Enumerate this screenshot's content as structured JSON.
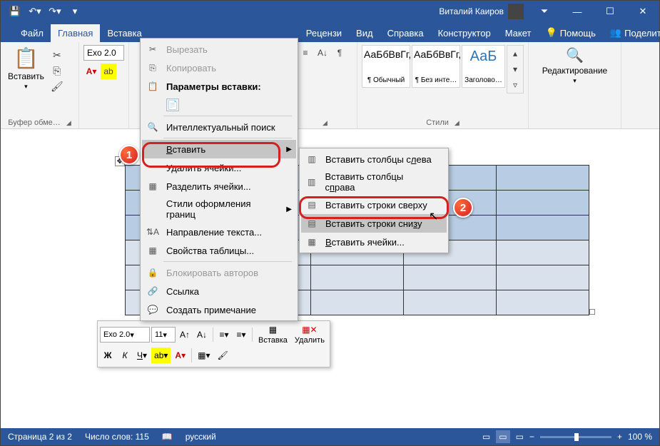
{
  "titlebar": {
    "user": "Виталий Каиров"
  },
  "tabs": {
    "file": "Файл",
    "home": "Главная",
    "insert": "Вставка",
    "review": "Рецензи",
    "view": "Вид",
    "help": "Справка",
    "design": "Конструктор",
    "layout": "Макет",
    "help_btn": "Помощь",
    "share": "Поделиться"
  },
  "ribbon": {
    "paste": "Вставить",
    "clipboard_group": "Буфер обме…",
    "font_name": "Exo 2.0",
    "styles_group": "Стили",
    "editing": "Редактирование",
    "styles": [
      {
        "preview": "АаБбВвГг,",
        "name": "¶ Обычный"
      },
      {
        "preview": "АаБбВвГг,",
        "name": "¶ Без инте…"
      },
      {
        "preview": "АаБ",
        "name": "Заголово…"
      }
    ]
  },
  "context_menu": {
    "cut": "Вырезать",
    "copy": "Копировать",
    "paste_options": "Параметры вставки:",
    "smart_lookup": "Интеллектуальный поиск",
    "insert": "Вставить",
    "delete_cells": "Удалить ячейки...",
    "split_cells": "Разделить ячейки...",
    "border_styles": "Стили оформления границ",
    "text_direction": "Направление текста...",
    "table_properties": "Свойства таблицы...",
    "block_authors": "Блокировать авторов",
    "link": "Ссылка",
    "new_comment": "Создать примечание"
  },
  "submenu": {
    "cols_left": "Вставить столбцы слева",
    "cols_right": "Вставить столбцы справа",
    "rows_above": "Вставить строки сверху",
    "rows_below": "Вставить строки снизу",
    "cells": "Вставить ячейки..."
  },
  "mini": {
    "font": "Exo 2.0",
    "size": "11",
    "insert": "Вставка",
    "delete": "Удалить"
  },
  "status": {
    "page": "Страница 2 из 2",
    "words": "Число слов: 115",
    "lang": "русский",
    "zoom": "100 %"
  },
  "callouts": {
    "b1": "1",
    "b2": "2"
  }
}
